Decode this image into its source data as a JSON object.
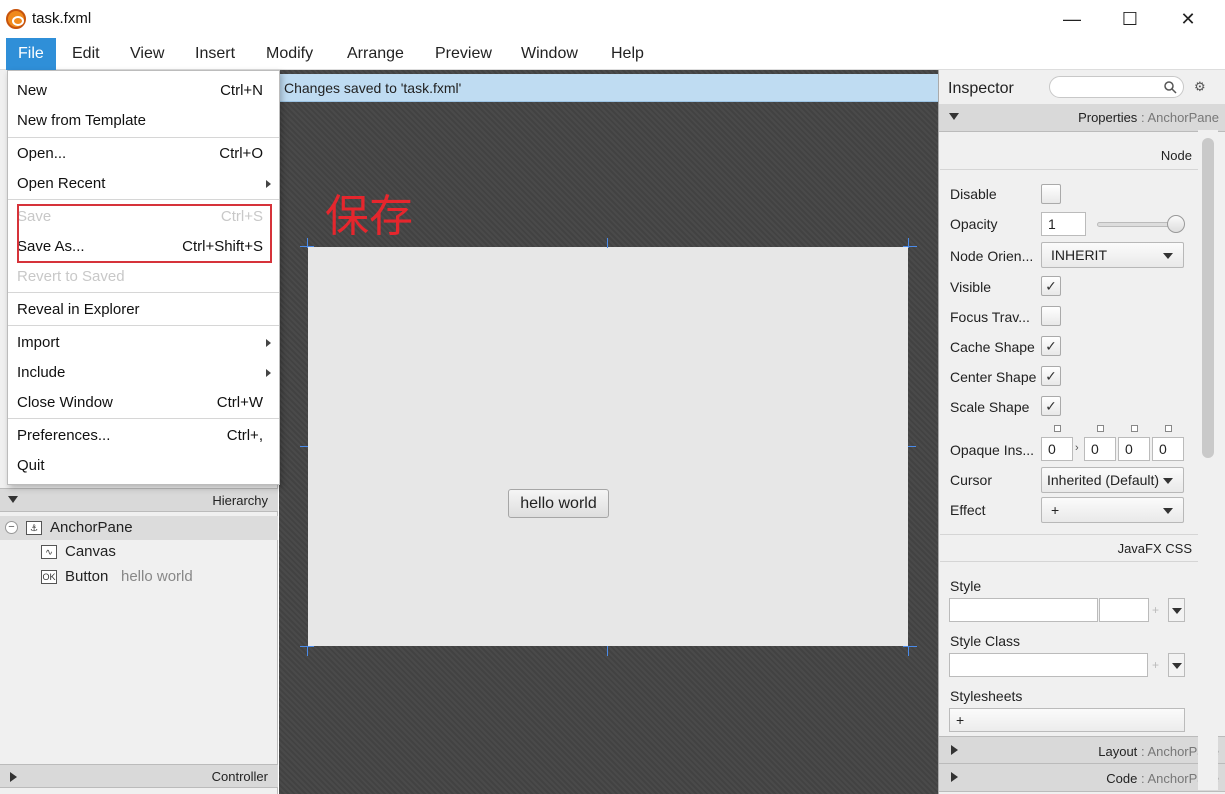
{
  "window": {
    "title": "task.fxml",
    "minimize": "—",
    "maximize": "☐",
    "close": "✕"
  },
  "menubar": [
    "File",
    "Edit",
    "View",
    "Insert",
    "Modify",
    "Arrange",
    "Preview",
    "Window",
    "Help"
  ],
  "status_message": "Changes saved to 'task.fxml'",
  "file_menu": {
    "new": {
      "label": "New",
      "shortcut": "Ctrl+N"
    },
    "new_from_template": {
      "label": "New from Template"
    },
    "open": {
      "label": "Open...",
      "shortcut": "Ctrl+O"
    },
    "open_recent": {
      "label": "Open Recent"
    },
    "save": {
      "label": "Save",
      "shortcut": "Ctrl+S"
    },
    "save_as": {
      "label": "Save As...",
      "shortcut": "Ctrl+Shift+S"
    },
    "revert": {
      "label": "Revert to Saved"
    },
    "reveal": {
      "label": "Reveal in Explorer"
    },
    "import": {
      "label": "Import"
    },
    "include": {
      "label": "Include"
    },
    "close_window": {
      "label": "Close Window",
      "shortcut": "Ctrl+W"
    },
    "preferences": {
      "label": "Preferences...",
      "shortcut": "Ctrl+,"
    },
    "quit": {
      "label": "Quit"
    }
  },
  "annotation_text": "保存",
  "hierarchy": {
    "title": "Hierarchy",
    "root": {
      "icon": "anchorpane-icon",
      "label": "AnchorPane"
    },
    "children": [
      {
        "icon": "canvas-icon",
        "label": "Canvas",
        "sub": ""
      },
      {
        "icon": "button-icon",
        "icon_text": "OK",
        "label": "Button",
        "sub": "hello world"
      }
    ]
  },
  "controller_label": "Controller",
  "canvas_button_label": "hello world",
  "inspector": {
    "title": "Inspector",
    "properties_header": "Properties",
    "properties_sub": ": AnchorPane",
    "node_section": "Node",
    "rows": {
      "disable": "Disable",
      "opacity": "Opacity",
      "opacity_value": "1",
      "node_orientation": "Node Orien...",
      "node_orientation_value": "INHERIT",
      "visible": "Visible",
      "focus_traversable": "Focus Trav...",
      "cache_shape": "Cache Shape",
      "center_shape": "Center Shape",
      "scale_shape": "Scale Shape",
      "opaque_insets": "Opaque Ins...",
      "opaque_values": [
        "0",
        "0",
        "0",
        "0"
      ],
      "cursor": "Cursor",
      "cursor_value": "Inherited (Default)",
      "effect": "Effect",
      "effect_value": "+"
    },
    "css_section": "JavaFX CSS",
    "style": "Style",
    "style_class": "Style Class",
    "stylesheets": "Stylesheets",
    "stylesheets_add": "+",
    "plus": "+",
    "layout_header": "Layout",
    "layout_sub": ": AnchorPane",
    "code_header": "Code",
    "code_sub": ": AnchorPane",
    "checks": {
      "visible": "✓",
      "cache_shape": "✓",
      "center_shape": "✓",
      "scale_shape": "✓"
    },
    "opacity_slider": 1.0
  },
  "colors": {
    "menu_active": "#2f8fd8",
    "status_bg": "#bfdcf2",
    "annotation": "#e5262d",
    "guide": "#4a8bea"
  }
}
